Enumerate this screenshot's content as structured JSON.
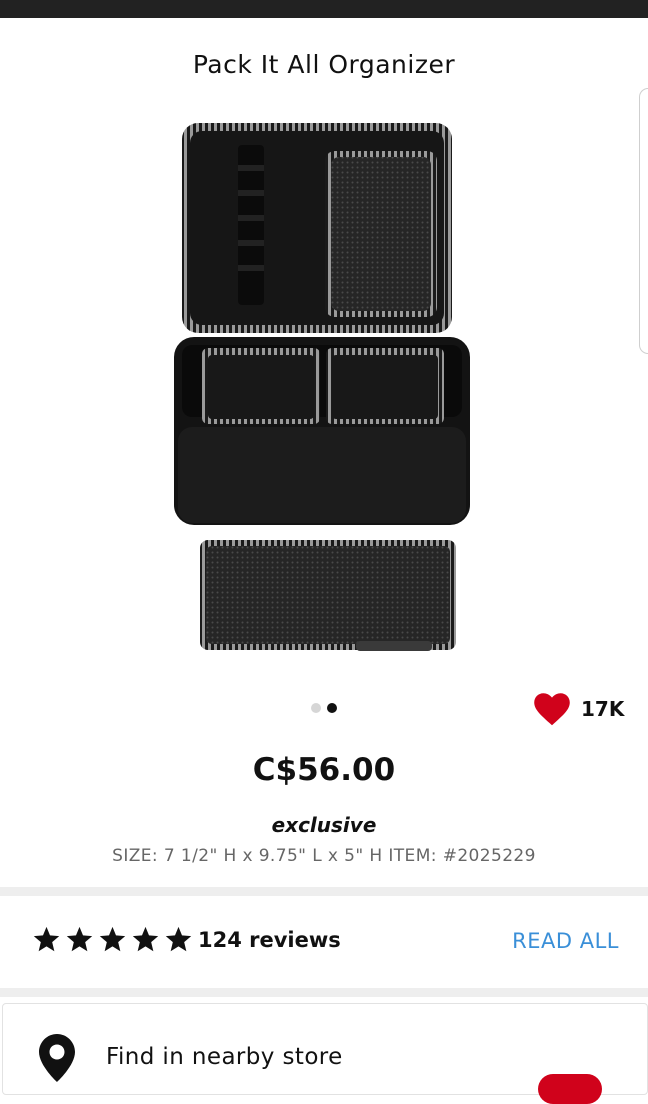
{
  "product": {
    "title": "Pack It All Organizer",
    "price": "C$56.00",
    "badge": "exclusive",
    "meta": "SIZE: 7 1/2\" H x 9.75\" L x 5\" H ITEM: #2025229",
    "image_icon": "toiletry-organizer-bag-image"
  },
  "carousel": {
    "total": 2,
    "active_index": 1
  },
  "loves": {
    "count": "17K",
    "icon": "heart-icon",
    "color": "#d0021b"
  },
  "reviews": {
    "rating_stars": 5,
    "count_label": "124 reviews",
    "read_all_label": "READ ALL",
    "link_color": "#3a8fd8"
  },
  "store": {
    "label": "Find in nearby store",
    "icon": "location-pin-icon"
  }
}
